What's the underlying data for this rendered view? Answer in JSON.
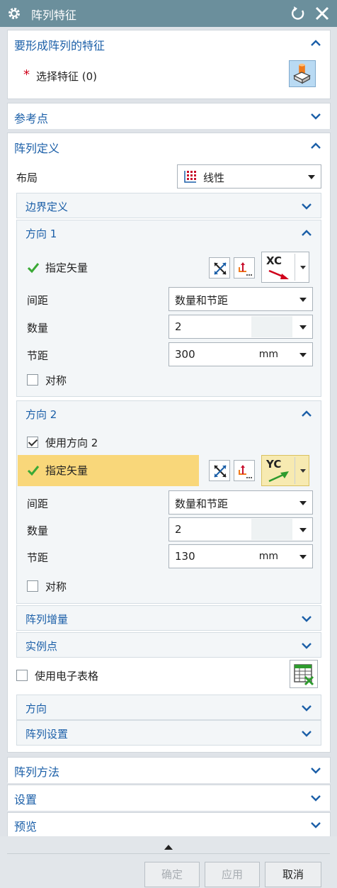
{
  "window": {
    "title": "阵列特征",
    "gear_icon": "gear-icon",
    "reset_icon": "reset-icon",
    "close_icon": "close-icon"
  },
  "sections": {
    "select": {
      "title": "要形成阵列的特征",
      "label": "选择特征 (0)",
      "required_mark": "*"
    },
    "ref_point": {
      "title": "参考点"
    },
    "array_def": {
      "title": "阵列定义",
      "layout_label": "布局",
      "layout_value": "线性",
      "boundary": "边界定义",
      "dir1": {
        "title": "方向 1",
        "vector_label": "指定矢量",
        "vector_value": "XC",
        "spacing_label": "间距",
        "spacing_value": "数量和节距",
        "count_label": "数量",
        "count_value": "2",
        "pitch_label": "节距",
        "pitch_value": "300",
        "pitch_unit": "mm",
        "symmetric_label": "对称"
      },
      "dir2": {
        "title": "方向 2",
        "use_label": "使用方向 2",
        "vector_label": "指定矢量",
        "vector_value": "YC",
        "spacing_label": "间距",
        "spacing_value": "数量和节距",
        "count_label": "数量",
        "count_value": "2",
        "pitch_label": "节距",
        "pitch_value": "130",
        "pitch_unit": "mm",
        "symmetric_label": "对称"
      },
      "increment": "阵列增量",
      "instance_point": "实例点",
      "spreadsheet_label": "使用电子表格",
      "orientation": "方向",
      "array_settings": "阵列设置"
    },
    "array_method": {
      "title": "阵列方法"
    },
    "settings": {
      "title": "设置"
    },
    "preview": {
      "title": "预览"
    }
  },
  "buttons": {
    "ok": "确定",
    "apply": "应用",
    "cancel": "取消"
  },
  "colors": {
    "titlebar": "#6b8f9c",
    "section_label": "#1b5fa8",
    "highlight": "#f9d77a",
    "required": "#d0021b",
    "check": "#3aa935"
  }
}
